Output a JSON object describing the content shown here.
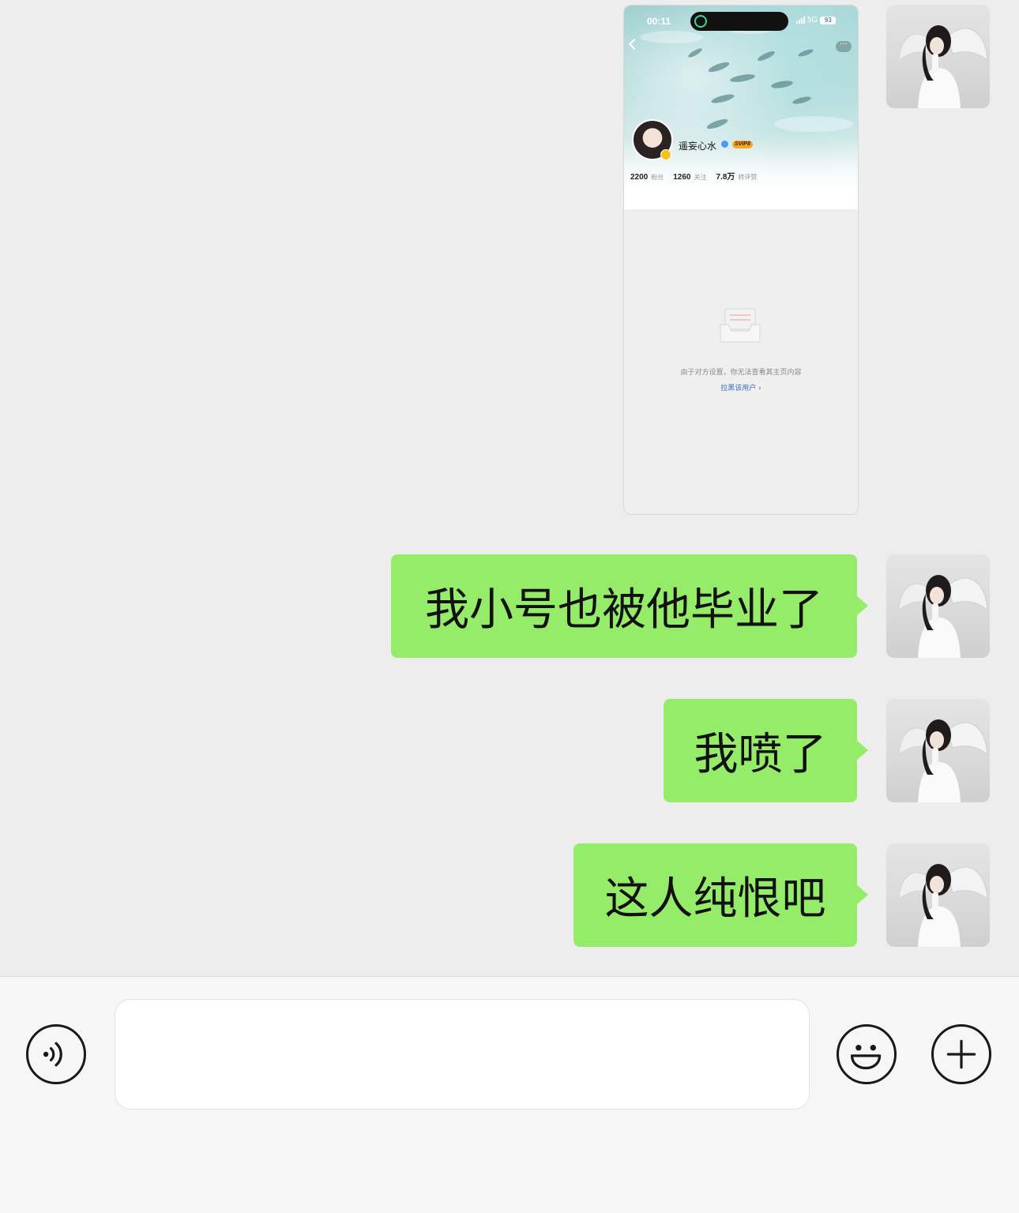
{
  "chat": {
    "messages": [
      {
        "type": "image",
        "sender": "me",
        "screenshot": {
          "status_time": "00:11",
          "status_network": "5G",
          "status_battery": "93",
          "profile_name": "遥妄心水",
          "vip_label": "SVIP8",
          "stats": [
            {
              "value": "2200",
              "label": "粉丝"
            },
            {
              "value": "1260",
              "label": "关注"
            },
            {
              "value": "7.8万",
              "label": "转评赞"
            }
          ],
          "empty_message": "由于对方设置，你无法查看其主页内容",
          "block_link": "拉黑该用户 ›"
        }
      },
      {
        "type": "text",
        "sender": "me",
        "text": "我小号也被他毕业了"
      },
      {
        "type": "text",
        "sender": "me",
        "text": "我喷了"
      },
      {
        "type": "text",
        "sender": "me",
        "text": "这人纯恨吧"
      }
    ]
  },
  "input_bar": {
    "voice_icon": "voice-icon",
    "message_value": "",
    "emoji_icon": "emoji-icon",
    "plus_icon": "plus-icon"
  },
  "colors": {
    "bubble": "#95ec69",
    "chat_bg": "#ededed",
    "input_bg": "#f6f6f6"
  }
}
